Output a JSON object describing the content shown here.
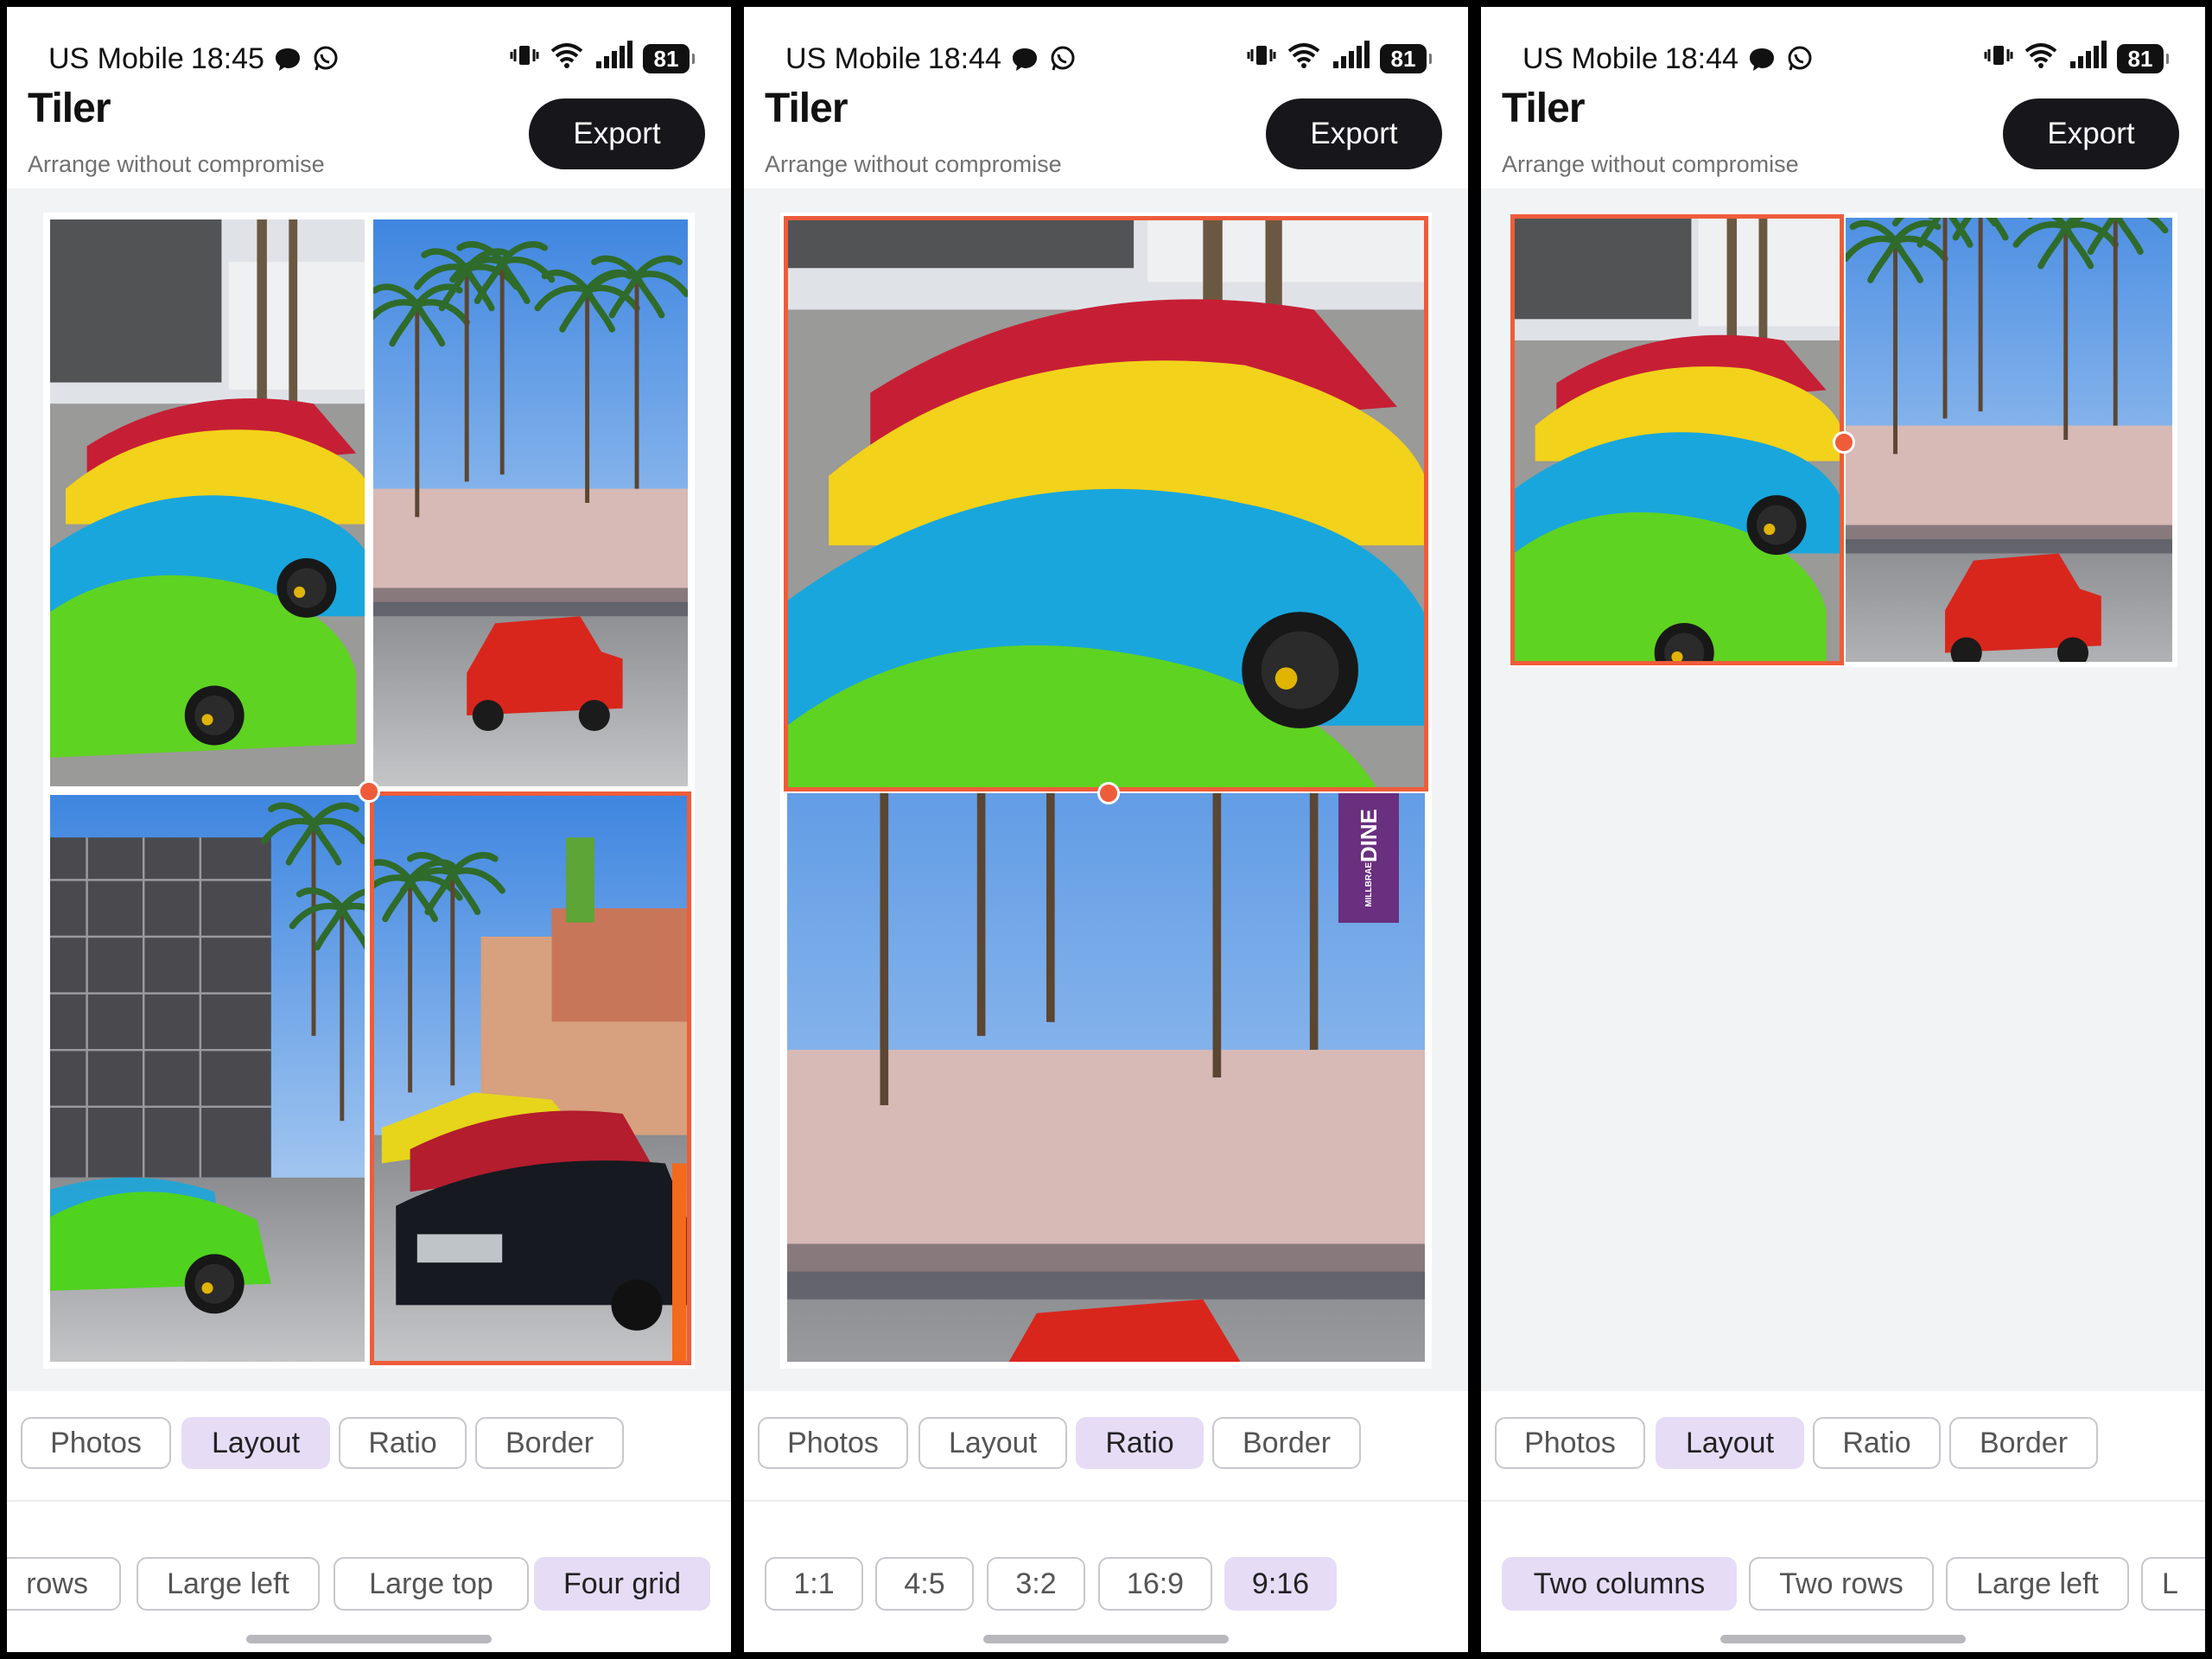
{
  "theme": {
    "accent": "#ee5c3a",
    "active_pill": "#e6dcf6",
    "export_button": "#17171b",
    "canvas_background": "#f2f3f5"
  },
  "screens": [
    {
      "status": {
        "carrier": "US Mobile",
        "time": "18:45",
        "battery": "81",
        "notification_icons": [
          "message-icon",
          "whatsapp-icon"
        ],
        "right_icons": [
          "vibrate-icon",
          "wifi-icon",
          "signal-icon",
          "battery-icon"
        ]
      },
      "app": {
        "title": "Tiler",
        "subtitle": "Arrange without compromise",
        "export_label": "Export"
      },
      "layout": "Four grid",
      "tiles": [
        "Colorful sports cars close-up",
        "Palm trees with red hot rod 104",
        "Scaffolded building with green car",
        "Vintage cars on shopping street"
      ],
      "selected_tile": 4,
      "tabs": [
        {
          "label": "Photos",
          "active": false
        },
        {
          "label": "Layout",
          "active": true
        },
        {
          "label": "Ratio",
          "active": false
        },
        {
          "label": "Border",
          "active": false
        }
      ],
      "options": [
        {
          "label": "rows",
          "active": false
        },
        {
          "label": "Large left",
          "active": false
        },
        {
          "label": "Large top",
          "active": false
        },
        {
          "label": "Four grid",
          "active": true
        }
      ]
    },
    {
      "status": {
        "carrier": "US Mobile",
        "time": "18:44",
        "battery": "81",
        "notification_icons": [
          "message-icon",
          "whatsapp-icon"
        ],
        "right_icons": [
          "vibrate-icon",
          "wifi-icon",
          "signal-icon",
          "battery-icon"
        ]
      },
      "app": {
        "title": "Tiler",
        "subtitle": "Arrange without compromise",
        "export_label": "Export"
      },
      "layout": "Two rows",
      "tiles": [
        "Colorful sports cars close-up",
        "Palm trees with red hot rod 104"
      ],
      "banner_text": {
        "main": "DINE",
        "sub": "MILLBRAE"
      },
      "selected_tile": 1,
      "tabs": [
        {
          "label": "Photos",
          "active": false
        },
        {
          "label": "Layout",
          "active": false
        },
        {
          "label": "Ratio",
          "active": true
        },
        {
          "label": "Border",
          "active": false
        }
      ],
      "options": [
        {
          "label": "1:1",
          "active": false
        },
        {
          "label": "4:5",
          "active": false
        },
        {
          "label": "3:2",
          "active": false
        },
        {
          "label": "16:9",
          "active": false
        },
        {
          "label": "9:16",
          "active": true
        }
      ]
    },
    {
      "status": {
        "carrier": "US Mobile",
        "time": "18:44",
        "battery": "81",
        "notification_icons": [
          "message-icon",
          "whatsapp-icon"
        ],
        "right_icons": [
          "vibrate-icon",
          "wifi-icon",
          "signal-icon",
          "battery-icon"
        ]
      },
      "app": {
        "title": "Tiler",
        "subtitle": "Arrange without compromise",
        "export_label": "Export"
      },
      "layout": "Two columns",
      "tiles": [
        "Colorful sports cars close-up",
        "Palm trees with red hot rod 104"
      ],
      "selected_tile": 1,
      "tabs": [
        {
          "label": "Photos",
          "active": false
        },
        {
          "label": "Layout",
          "active": true
        },
        {
          "label": "Ratio",
          "active": false
        },
        {
          "label": "Border",
          "active": false
        }
      ],
      "options": [
        {
          "label": "Two columns",
          "active": true
        },
        {
          "label": "Two rows",
          "active": false
        },
        {
          "label": "Large left",
          "active": false
        },
        {
          "label": "L",
          "active": false
        }
      ]
    }
  ]
}
